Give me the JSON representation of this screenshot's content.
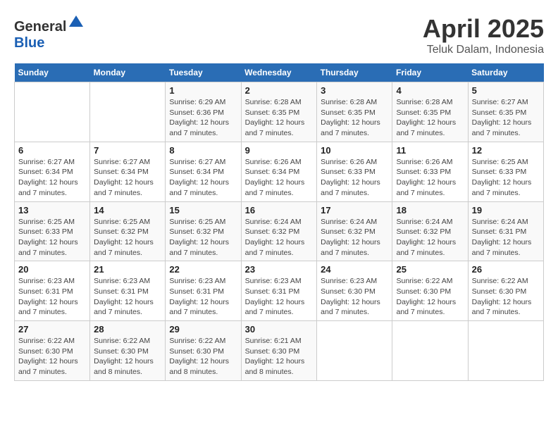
{
  "header": {
    "logo_general": "General",
    "logo_blue": "Blue",
    "title": "April 2025",
    "subtitle": "Teluk Dalam, Indonesia"
  },
  "days_of_week": [
    "Sunday",
    "Monday",
    "Tuesday",
    "Wednesday",
    "Thursday",
    "Friday",
    "Saturday"
  ],
  "weeks": [
    [
      {
        "day": "",
        "info": ""
      },
      {
        "day": "",
        "info": ""
      },
      {
        "day": "1",
        "info": "Sunrise: 6:29 AM\nSunset: 6:36 PM\nDaylight: 12 hours and 7 minutes."
      },
      {
        "day": "2",
        "info": "Sunrise: 6:28 AM\nSunset: 6:35 PM\nDaylight: 12 hours and 7 minutes."
      },
      {
        "day": "3",
        "info": "Sunrise: 6:28 AM\nSunset: 6:35 PM\nDaylight: 12 hours and 7 minutes."
      },
      {
        "day": "4",
        "info": "Sunrise: 6:28 AM\nSunset: 6:35 PM\nDaylight: 12 hours and 7 minutes."
      },
      {
        "day": "5",
        "info": "Sunrise: 6:27 AM\nSunset: 6:35 PM\nDaylight: 12 hours and 7 minutes."
      }
    ],
    [
      {
        "day": "6",
        "info": "Sunrise: 6:27 AM\nSunset: 6:34 PM\nDaylight: 12 hours and 7 minutes."
      },
      {
        "day": "7",
        "info": "Sunrise: 6:27 AM\nSunset: 6:34 PM\nDaylight: 12 hours and 7 minutes."
      },
      {
        "day": "8",
        "info": "Sunrise: 6:27 AM\nSunset: 6:34 PM\nDaylight: 12 hours and 7 minutes."
      },
      {
        "day": "9",
        "info": "Sunrise: 6:26 AM\nSunset: 6:34 PM\nDaylight: 12 hours and 7 minutes."
      },
      {
        "day": "10",
        "info": "Sunrise: 6:26 AM\nSunset: 6:33 PM\nDaylight: 12 hours and 7 minutes."
      },
      {
        "day": "11",
        "info": "Sunrise: 6:26 AM\nSunset: 6:33 PM\nDaylight: 12 hours and 7 minutes."
      },
      {
        "day": "12",
        "info": "Sunrise: 6:25 AM\nSunset: 6:33 PM\nDaylight: 12 hours and 7 minutes."
      }
    ],
    [
      {
        "day": "13",
        "info": "Sunrise: 6:25 AM\nSunset: 6:33 PM\nDaylight: 12 hours and 7 minutes."
      },
      {
        "day": "14",
        "info": "Sunrise: 6:25 AM\nSunset: 6:32 PM\nDaylight: 12 hours and 7 minutes."
      },
      {
        "day": "15",
        "info": "Sunrise: 6:25 AM\nSunset: 6:32 PM\nDaylight: 12 hours and 7 minutes."
      },
      {
        "day": "16",
        "info": "Sunrise: 6:24 AM\nSunset: 6:32 PM\nDaylight: 12 hours and 7 minutes."
      },
      {
        "day": "17",
        "info": "Sunrise: 6:24 AM\nSunset: 6:32 PM\nDaylight: 12 hours and 7 minutes."
      },
      {
        "day": "18",
        "info": "Sunrise: 6:24 AM\nSunset: 6:32 PM\nDaylight: 12 hours and 7 minutes."
      },
      {
        "day": "19",
        "info": "Sunrise: 6:24 AM\nSunset: 6:31 PM\nDaylight: 12 hours and 7 minutes."
      }
    ],
    [
      {
        "day": "20",
        "info": "Sunrise: 6:23 AM\nSunset: 6:31 PM\nDaylight: 12 hours and 7 minutes."
      },
      {
        "day": "21",
        "info": "Sunrise: 6:23 AM\nSunset: 6:31 PM\nDaylight: 12 hours and 7 minutes."
      },
      {
        "day": "22",
        "info": "Sunrise: 6:23 AM\nSunset: 6:31 PM\nDaylight: 12 hours and 7 minutes."
      },
      {
        "day": "23",
        "info": "Sunrise: 6:23 AM\nSunset: 6:31 PM\nDaylight: 12 hours and 7 minutes."
      },
      {
        "day": "24",
        "info": "Sunrise: 6:23 AM\nSunset: 6:30 PM\nDaylight: 12 hours and 7 minutes."
      },
      {
        "day": "25",
        "info": "Sunrise: 6:22 AM\nSunset: 6:30 PM\nDaylight: 12 hours and 7 minutes."
      },
      {
        "day": "26",
        "info": "Sunrise: 6:22 AM\nSunset: 6:30 PM\nDaylight: 12 hours and 7 minutes."
      }
    ],
    [
      {
        "day": "27",
        "info": "Sunrise: 6:22 AM\nSunset: 6:30 PM\nDaylight: 12 hours and 7 minutes."
      },
      {
        "day": "28",
        "info": "Sunrise: 6:22 AM\nSunset: 6:30 PM\nDaylight: 12 hours and 8 minutes."
      },
      {
        "day": "29",
        "info": "Sunrise: 6:22 AM\nSunset: 6:30 PM\nDaylight: 12 hours and 8 minutes."
      },
      {
        "day": "30",
        "info": "Sunrise: 6:21 AM\nSunset: 6:30 PM\nDaylight: 12 hours and 8 minutes."
      },
      {
        "day": "",
        "info": ""
      },
      {
        "day": "",
        "info": ""
      },
      {
        "day": "",
        "info": ""
      }
    ]
  ]
}
